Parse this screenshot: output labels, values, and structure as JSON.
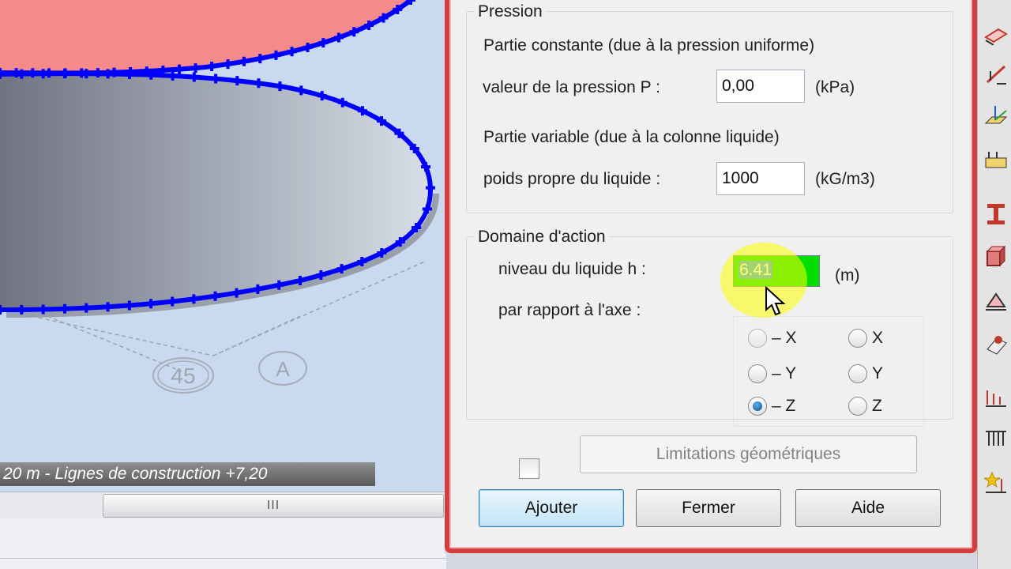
{
  "viewport": {
    "bubbles": [
      "45",
      "A"
    ],
    "status_line": "20 m - Lignes de construction +7,20",
    "scroll_grip": "III",
    "colors": {
      "surface_fill": "#f48a8a",
      "edge_line": "#0000ff",
      "background": "#c9d9ef"
    }
  },
  "dialog": {
    "pression": {
      "title": "Pression",
      "constant_label": "Partie constante (due à la pression uniforme)",
      "pressure_label": "valeur de la pression  P :",
      "pressure_value": "0,00",
      "pressure_unit": "(kPa)",
      "variable_label": "Partie variable (due à la colonne liquide)",
      "weight_label": "poids propre du liquide :",
      "weight_value": "1000",
      "weight_unit": "(kG/m3)"
    },
    "domaine": {
      "title": "Domaine d'action",
      "level_label": "niveau du liquide h :",
      "level_value": "6.41",
      "level_unit": "(m)",
      "axis_label": "par rapport à l'axe :",
      "radios": {
        "neg_x": "– X",
        "pos_x": "X",
        "neg_y": "– Y",
        "pos_y": "Y",
        "neg_z": "– Z",
        "pos_z": "Z"
      },
      "selected_axis": "neg_z"
    },
    "limitations_button": "Limitations géométriques",
    "buttons": {
      "add": "Ajouter",
      "close": "Fermer",
      "help": "Aide"
    }
  },
  "toolbar": {
    "icons": [
      "slab-icon",
      "load-arrow-icon",
      "axes-icon",
      "support-icon",
      "beam-icon",
      "solid-icon",
      "pin-support-icon",
      "node-icon",
      "distributed-load-icon",
      "grid-load-icon",
      "special-load-icon"
    ]
  }
}
